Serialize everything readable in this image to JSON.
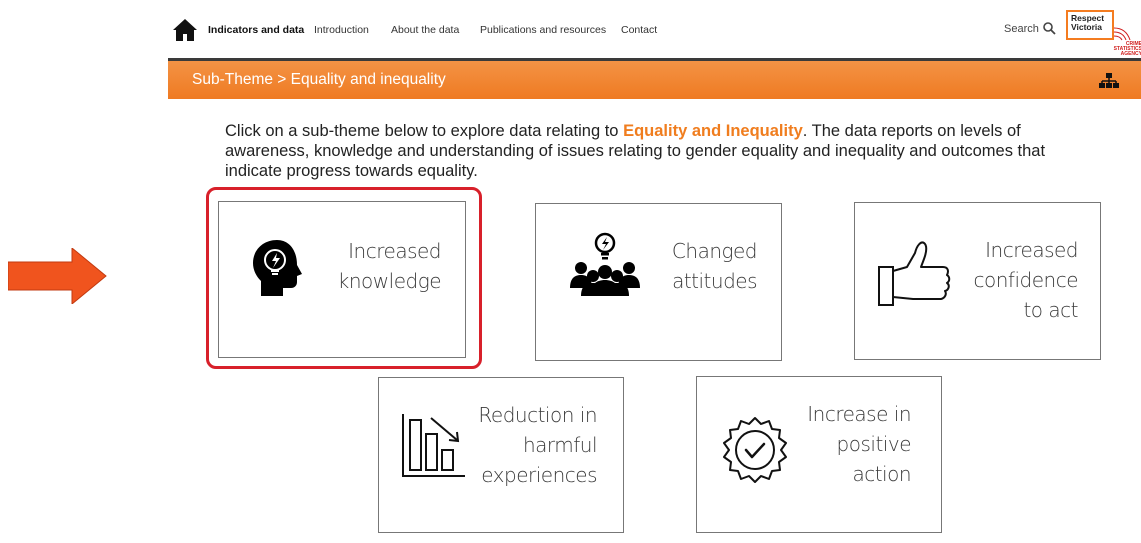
{
  "nav": {
    "items": [
      "Indicators and data",
      "Introduction",
      "About the data",
      "Publications and resources",
      "Contact"
    ],
    "search_label": "Search",
    "logo_line1": "Respect",
    "logo_line2": "Victoria",
    "logo_sub": "CRIME STATISTICS AGENCY"
  },
  "banner": {
    "breadcrumb": "Sub-Theme > Equality and inequality"
  },
  "intro": {
    "before": "Click on a sub-theme below to explore data relating to ",
    "highlight": "Equality and Inequality",
    "after": ". The data reports on levels of awareness, knowledge and understanding of issues relating to gender equality and inequality and outcomes that indicate progress towards equality."
  },
  "cards": [
    {
      "lines": [
        "Increased",
        "knowledge"
      ],
      "icon": "head-lightbulb-icon"
    },
    {
      "lines": [
        "Changed",
        "attitudes"
      ],
      "icon": "group-lightbulb-icon"
    },
    {
      "lines": [
        "Increased",
        "confidence",
        "to act"
      ],
      "icon": "thumbs-up-icon"
    },
    {
      "lines": [
        "Reduction in",
        "harmful",
        "experiences"
      ],
      "icon": "declining-chart-icon"
    },
    {
      "lines": [
        "Increase in",
        "positive",
        "action"
      ],
      "icon": "badge-check-icon"
    }
  ],
  "colors": {
    "accent": "#f07d1e",
    "arrow": "#f0541e",
    "highlight_border": "#d8202a"
  }
}
